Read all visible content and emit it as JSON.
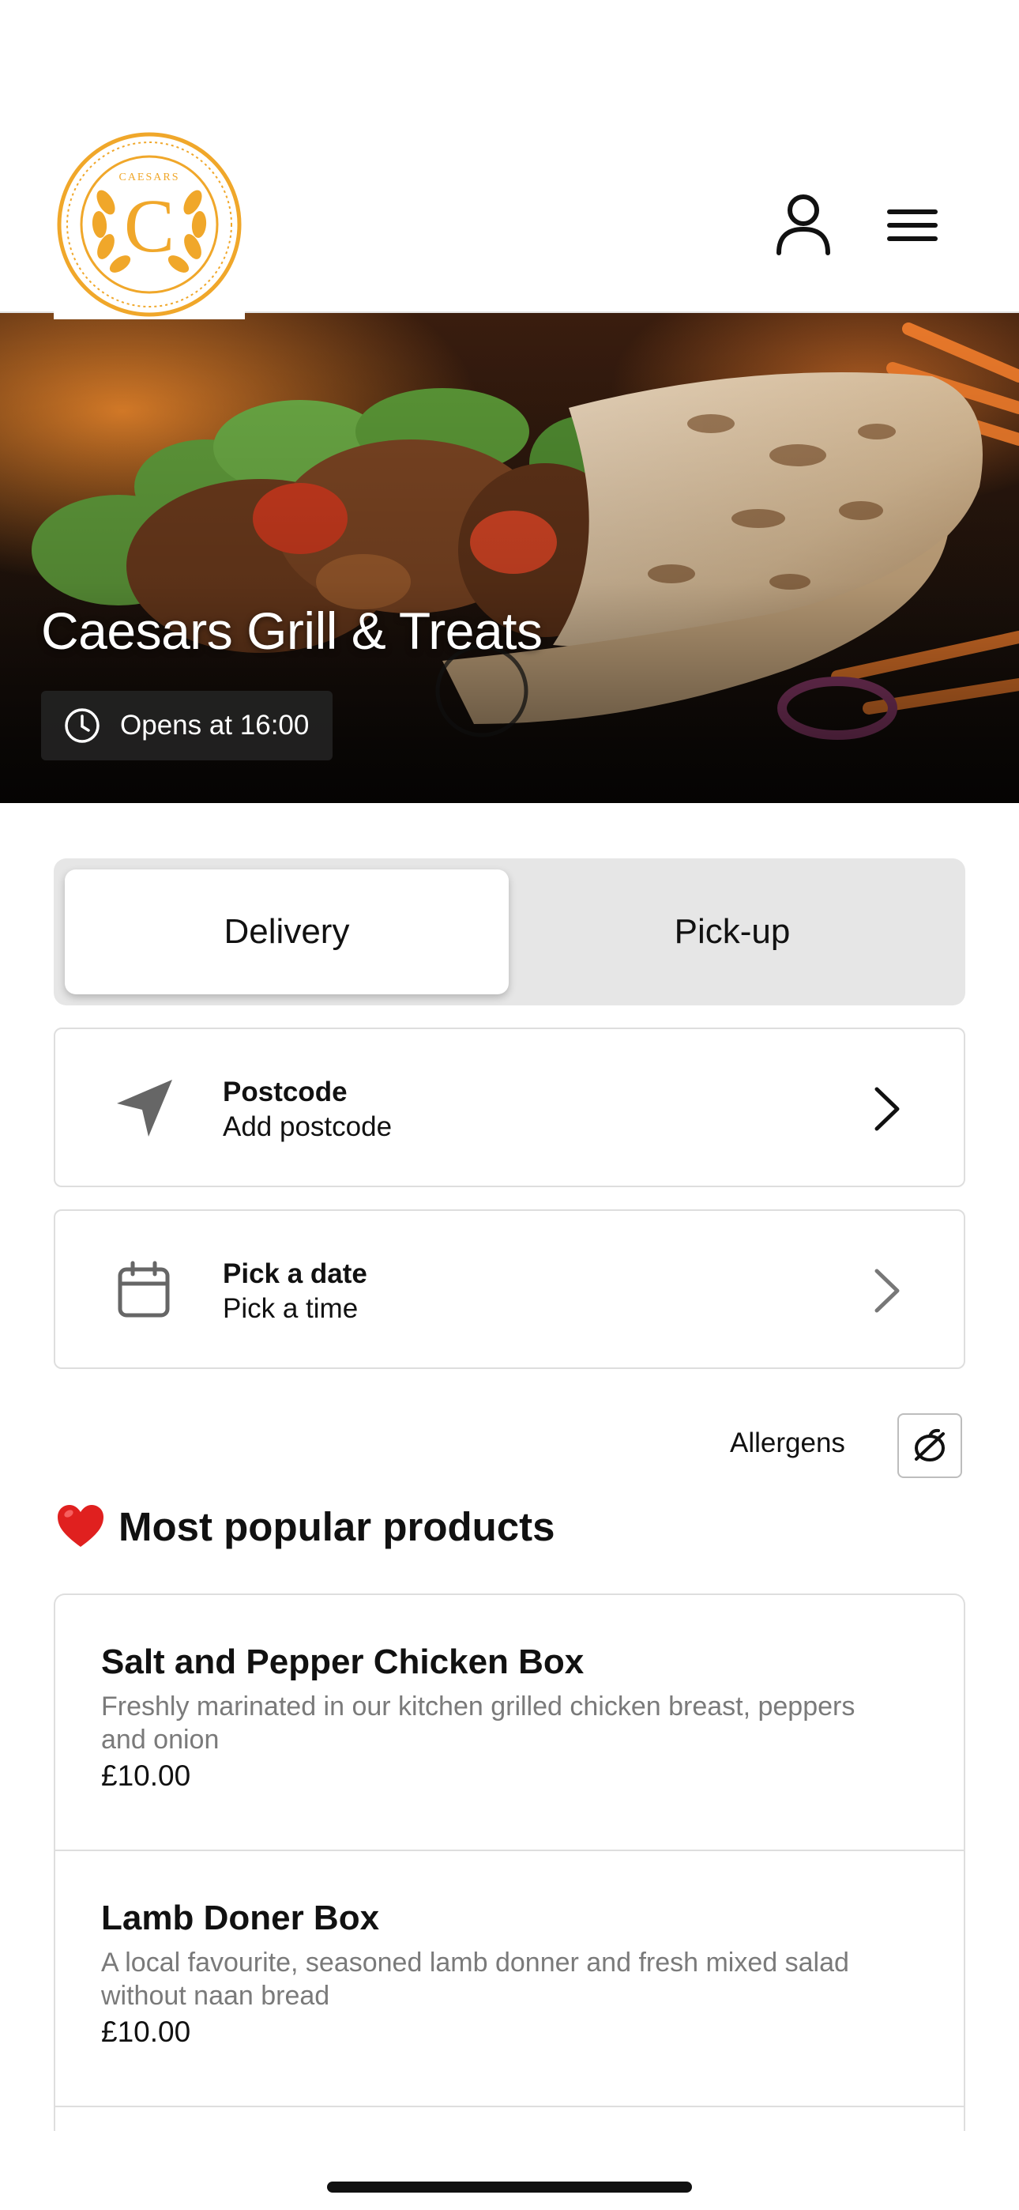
{
  "header": {
    "logo_text": "CAESARS",
    "logo_letter": "C",
    "account_icon": "account-icon",
    "menu_icon": "hamburger-menu-icon"
  },
  "hero": {
    "title": "Caesars Grill & Treats",
    "status": "Opens at 16:00",
    "status_icon": "clock-icon"
  },
  "order_mode": {
    "options": [
      "Delivery",
      "Pick-up"
    ],
    "selected": "Delivery"
  },
  "postcode": {
    "title": "Postcode",
    "subtitle": "Add postcode",
    "icon": "location-arrow-icon"
  },
  "datetime": {
    "title": "Pick a date",
    "subtitle": "Pick a time",
    "icon": "calendar-icon"
  },
  "allergens": {
    "label": "Allergens",
    "icon": "allergen-icon"
  },
  "popular": {
    "heading": "Most popular products",
    "heading_icon": "heart-icon",
    "products": [
      {
        "name": "Salt and Pepper Chicken  Box",
        "description": "Freshly marinated in our kitchen grilled chicken breast, peppers and onion",
        "price": "£10.00"
      },
      {
        "name": "Lamb Doner Box",
        "description": "A local favourite, seasoned lamb donner and fresh mixed salad without naan bread",
        "price": "£10.00"
      }
    ]
  },
  "colors": {
    "brand_gold": "#F0A72A",
    "segment_bg": "#E6E6E6",
    "muted_text": "#7A7A7A",
    "heart_red": "#E0201F"
  }
}
